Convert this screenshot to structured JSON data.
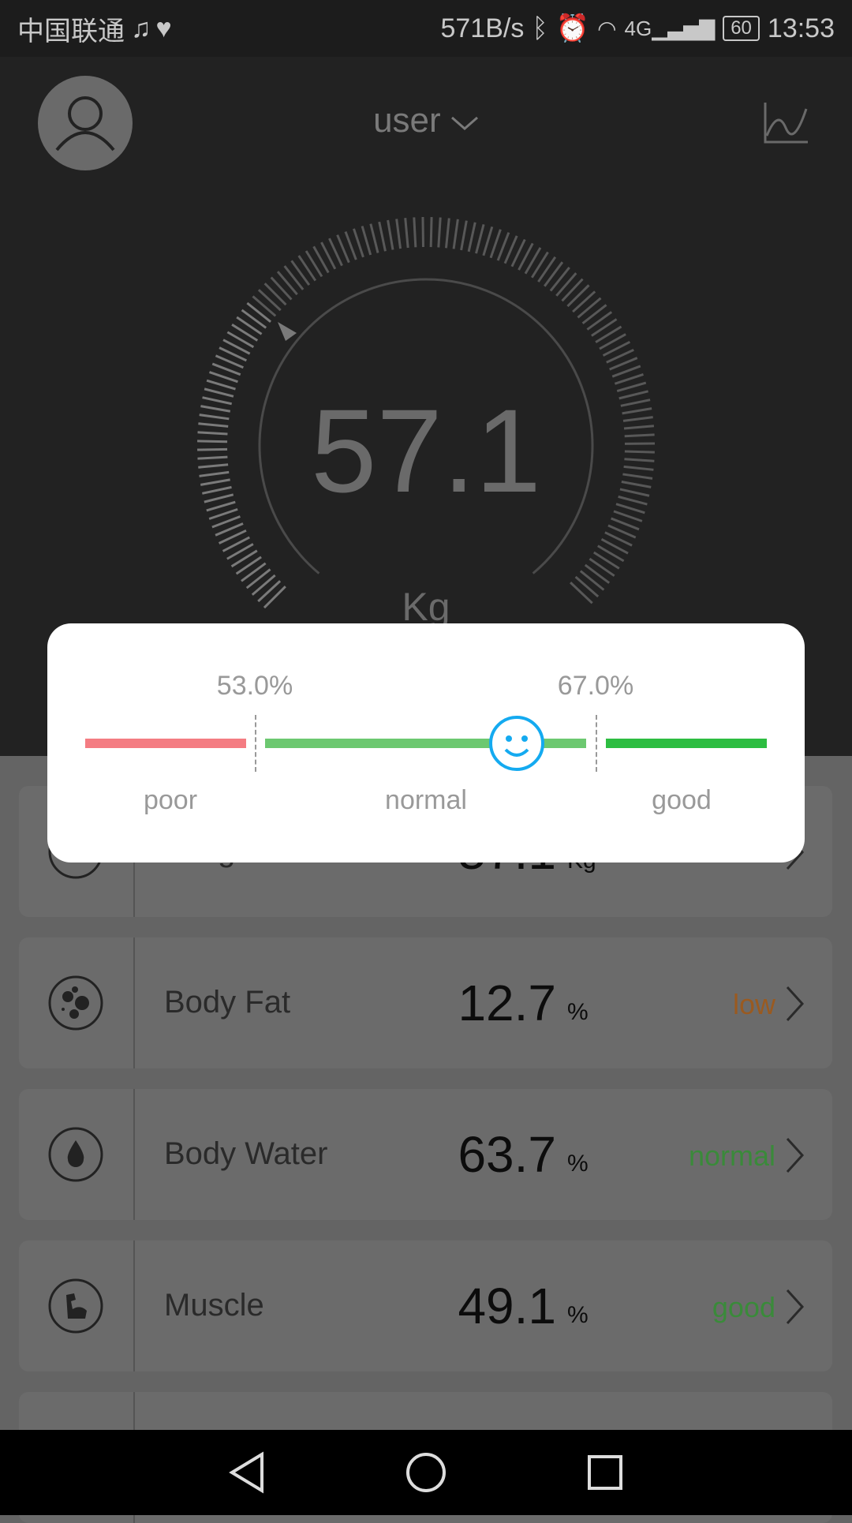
{
  "status_bar": {
    "carrier": "中国联通",
    "net_speed": "571B/s",
    "battery": "60",
    "time": "13:53",
    "icons": [
      "music-icon",
      "heart-rate-icon",
      "bluetooth-icon",
      "alarm-icon",
      "wifi-icon",
      "4g-signal-icon",
      "battery-icon"
    ]
  },
  "header": {
    "user_label": "user",
    "weight_value": "57.1",
    "weight_unit": "Kg"
  },
  "popup": {
    "low_threshold": "53.0%",
    "high_threshold": "67.0%",
    "ranges": [
      "poor",
      "normal",
      "good"
    ],
    "current_range": "normal",
    "colors": {
      "poor": "#f47c82",
      "normal": "#6cc870",
      "good": "#2dbd41",
      "indicator": "#14aaf0"
    }
  },
  "metrics": [
    {
      "name": "Weight",
      "value": "57.1",
      "unit": "Kg",
      "status": "",
      "icon": "weight-icon"
    },
    {
      "name": "Body Fat",
      "value": "12.7",
      "unit": "%",
      "status": "low",
      "status_color": "#9a5a20",
      "icon": "body-fat-icon"
    },
    {
      "name": "Body Water",
      "value": "63.7",
      "unit": "%",
      "status": "normal",
      "status_color": "#3a8a3a",
      "icon": "water-drop-icon"
    },
    {
      "name": "Muscle",
      "value": "49.1",
      "unit": "%",
      "status": "good",
      "status_color": "#3a8a3a",
      "icon": "muscle-icon"
    }
  ]
}
